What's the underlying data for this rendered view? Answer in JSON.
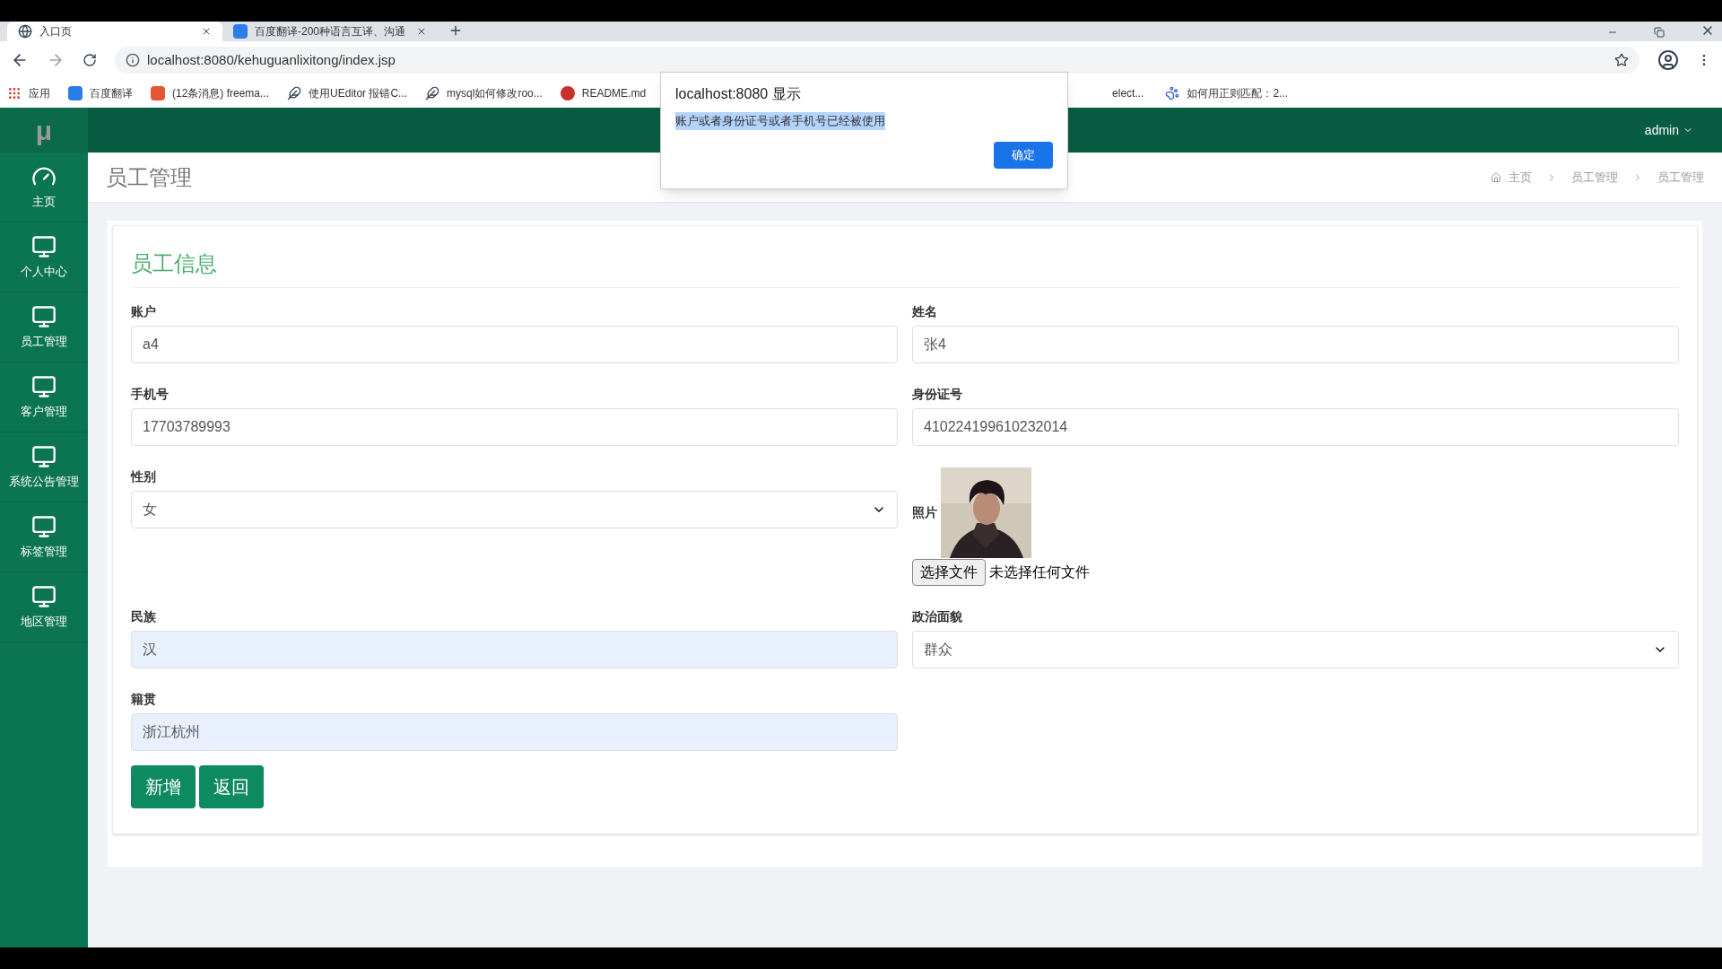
{
  "browser": {
    "tabs": [
      {
        "title": "入口页",
        "selected": true
      },
      {
        "title": "百度翻译-200种语言互译、沟通",
        "selected": false
      }
    ],
    "url": "localhost:8080/kehuguanlixitong/index.jsp",
    "bookmarks": [
      "应用",
      "百度翻译",
      "(12条消息) freema...",
      "使用UEditor 报错C...",
      "mysql如何修改roo...",
      "README.md",
      "elect...",
      "如何用正则匹配：2..."
    ]
  },
  "app": {
    "logo": "μ",
    "user": "admin",
    "sidebar": {
      "items": [
        "主页",
        "个人中心",
        "员工管理",
        "客户管理",
        "系统公告管理",
        "标签管理",
        "地区管理"
      ]
    },
    "page_title": "员工管理",
    "breadcrumb": [
      "主页",
      "员工管理",
      "员工管理"
    ],
    "card": {
      "title": "员工信息",
      "fields": [
        {
          "label": "账户",
          "kind": "text",
          "value": "a4",
          "autofilled": false
        },
        {
          "label": "姓名",
          "kind": "text",
          "value": "张4",
          "autofilled": false
        },
        {
          "label": "手机号",
          "kind": "text",
          "value": "17703789993",
          "autofilled": false
        },
        {
          "label": "身份证号",
          "kind": "text",
          "value": "410224199610232014",
          "autofilled": false
        },
        {
          "label": "性别",
          "kind": "select",
          "value": "女",
          "autofilled": false
        },
        {
          "label": "照片",
          "file_button": "选择文件",
          "file_status": "未选择任何文件"
        },
        {
          "label": "民族",
          "kind": "text",
          "value": "汉",
          "autofilled": true
        },
        {
          "label": "政治面貌",
          "kind": "select",
          "value": "群众",
          "autofilled": false
        },
        {
          "label": "籍贯",
          "kind": "text",
          "value": "浙江杭州",
          "autofilled": true
        }
      ],
      "buttons": [
        "新增",
        "返回"
      ]
    }
  },
  "dialog": {
    "title": "localhost:8080 显示",
    "message": "账户或者身份证号或者手机号已经被使用",
    "message_selected": true,
    "button": "确定"
  }
}
